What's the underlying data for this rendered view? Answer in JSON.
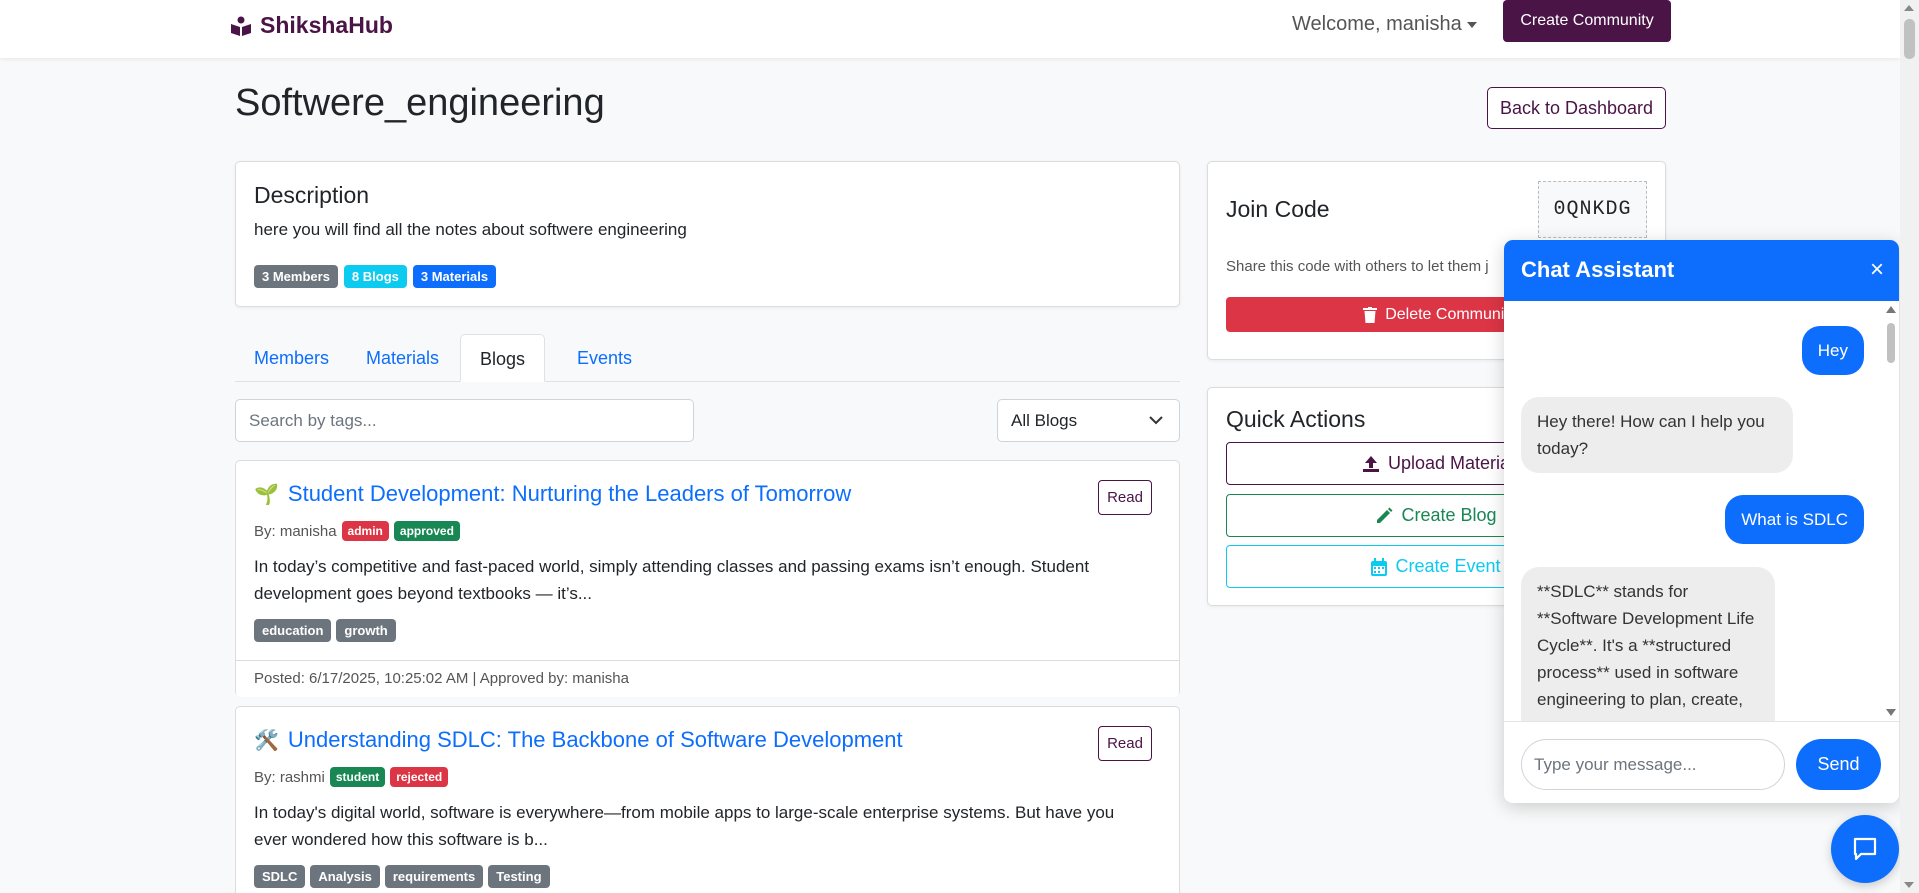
{
  "navbar": {
    "brand": "ShikshaHub",
    "welcome": "Welcome, manisha",
    "create_community": "Create Community"
  },
  "community": {
    "title": "Softwere_engineering",
    "back_label": "Back to Dashboard",
    "description_heading": "Description",
    "description": "here you will find all the notes about softwere engineering",
    "badges": {
      "members": "3 Members",
      "blogs": "8 Blogs",
      "materials": "3 Materials"
    }
  },
  "tabs": [
    {
      "label": "Members",
      "active": false
    },
    {
      "label": "Materials",
      "active": false
    },
    {
      "label": "Blogs",
      "active": true
    },
    {
      "label": "Events",
      "active": false
    }
  ],
  "filters": {
    "search_placeholder": "Search by tags...",
    "blog_filter": "All Blogs"
  },
  "blogs": [
    {
      "emoji": "🌱",
      "title": "Student Development: Nurturing the Leaders of Tomorrow",
      "read_label": "Read",
      "author": "By: manisha",
      "role": "admin",
      "status": "approved",
      "excerpt": "In today’s competitive and fast-paced world, simply attending classes and passing exams isn’t enough. Student development goes beyond textbooks — it’s...",
      "tags": [
        "education",
        "growth"
      ],
      "footer": "Posted: 6/17/2025, 10:25:02 AM | Approved by: manisha"
    },
    {
      "emoji": "🛠️",
      "title": "Understanding SDLC: The Backbone of Software Development",
      "read_label": "Read",
      "author": "By: rashmi",
      "role": "student",
      "status": "rejected",
      "excerpt": "In today's digital world, software is everywhere—from mobile apps to large-scale enterprise systems. But have you ever wondered how this software is b...",
      "tags": [
        "SDLC",
        "Analysis",
        "requirements",
        "Testing"
      ]
    }
  ],
  "join": {
    "heading": "Join Code",
    "code": "0QNKDG",
    "hint": "Share this code with others to let them j",
    "delete_label": "Delete Communit"
  },
  "quick_actions": {
    "heading": "Quick Actions",
    "upload": "Upload Materia",
    "create_blog": "Create Blog",
    "create_event": "Create Event"
  },
  "chat": {
    "title": "Chat Assistant",
    "close": "×",
    "messages": [
      {
        "from": "user",
        "text": "Hey"
      },
      {
        "from": "bot",
        "text": "Hey there! How can I help you today?"
      },
      {
        "from": "user",
        "text": "What is SDLC"
      },
      {
        "from": "bot",
        "text": "**SDLC** stands for **Software Development Life Cycle**. It's a **structured process** used in software engineering to plan, create,"
      }
    ],
    "input_placeholder": "Type your message...",
    "send_label": "Send"
  },
  "colors": {
    "brand": "#4a1446",
    "primary": "#0d6efd",
    "danger": "#dc3545",
    "success": "#198754",
    "info": "#0dcaf0",
    "secondary": "#6c757d"
  }
}
